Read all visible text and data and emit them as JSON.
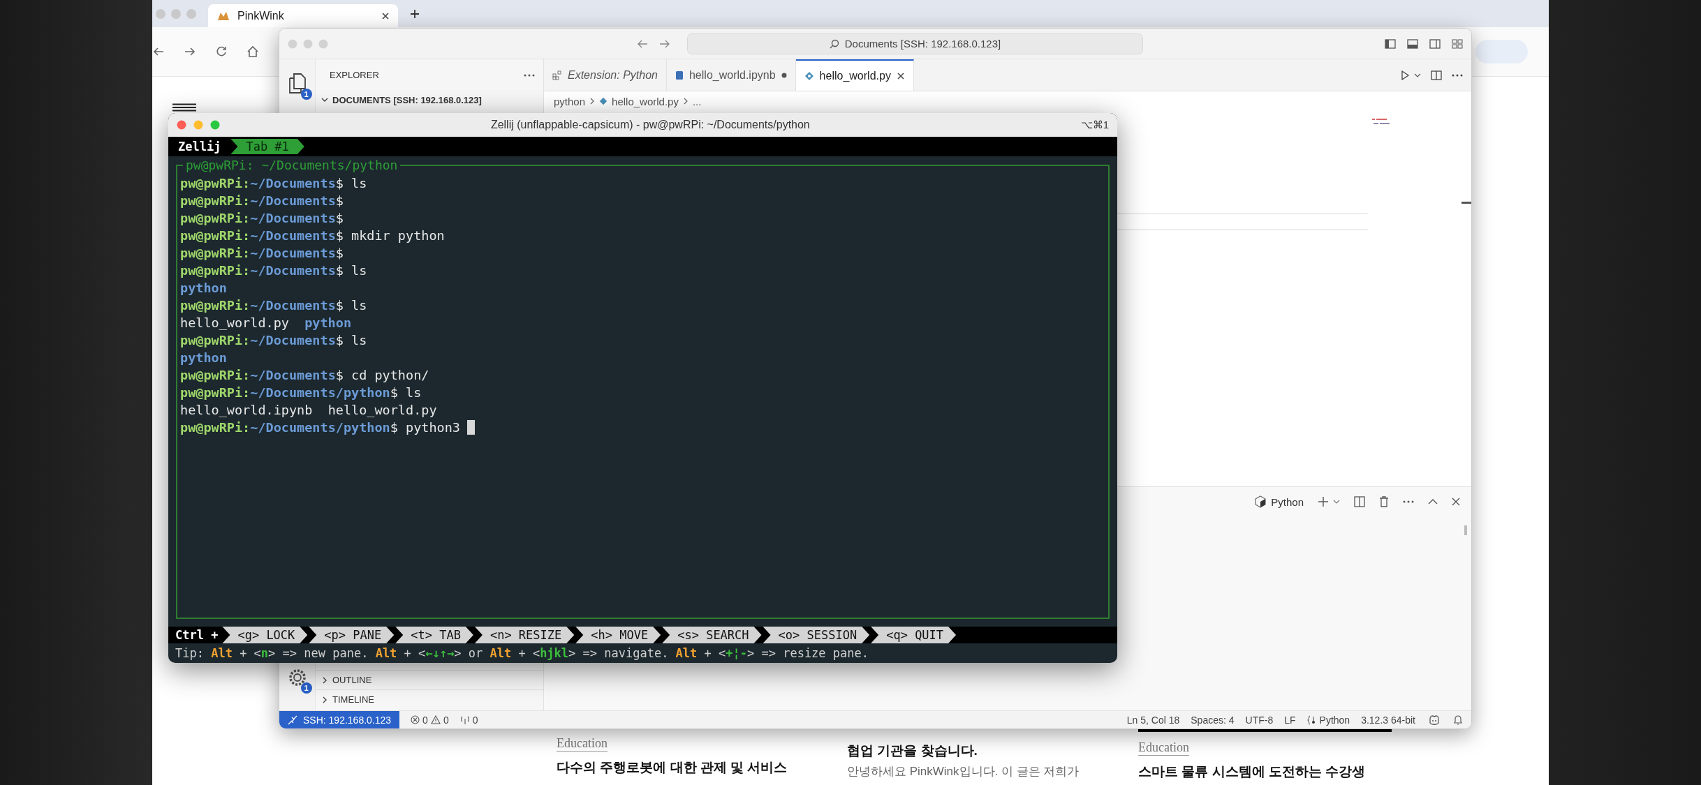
{
  "browser": {
    "tab_title": "PinkWink"
  },
  "page": {
    "columns": [
      {
        "category": "Education",
        "title": "다수의 주행로봇에 대한 관제 및 서비스"
      },
      {
        "title": "협업 기관을 찾습니다.",
        "excerpt": "안녕하세요 PinkWink입니다. 이 글은 저희가"
      },
      {
        "banner": true,
        "category": "Education",
        "title": "스마트 물류 시스템에 도전하는 수강생"
      }
    ]
  },
  "vscode": {
    "search": "Documents [SSH: 192.168.0.123]",
    "explorer_badge": "1",
    "settings_badge": "1",
    "explorer_title": "EXPLORER",
    "folder": {
      "label": "DOCUMENTS [SSH: 192.168.0.123]",
      "expanded": true
    },
    "sections": [
      {
        "label": "OUTLINE",
        "expanded": false
      },
      {
        "label": "TIMELINE",
        "expanded": false
      }
    ],
    "tabs": [
      {
        "label": "Extension: Python",
        "kind": "extension",
        "selected": false,
        "dirty": false
      },
      {
        "label": "hello_world.ipynb",
        "kind": "notebook",
        "selected": false,
        "dirty": true
      },
      {
        "label": "hello_world.py",
        "kind": "python",
        "selected": true,
        "dirty": false
      }
    ],
    "breadcrumb": [
      "python",
      "hello_world.py",
      "..."
    ],
    "panel": {
      "terminal_label": "Python"
    },
    "status_bar": {
      "remote": "SSH: 192.168.0.123",
      "errors": "0",
      "warnings": "0",
      "ports": "0",
      "position": "Ln 5, Col 18",
      "indent": "Spaces: 4",
      "encoding": "UTF-8",
      "eol": "LF",
      "language": "Python",
      "interpreter": "3.12.3 64-bit"
    }
  },
  "zellij": {
    "title": "Zellij (unflappable-capsicum) - pw@pwRPi: ~/Documents/python",
    "shortcut": "⌥⌘1",
    "session_label": "Zellij",
    "tabs": [
      {
        "label": "Tab #1",
        "selected": true
      }
    ],
    "pane_title": "pw@pwRPi: ~/Documents/python",
    "lines": [
      {
        "kind": "prompt",
        "user": "pw@pwRPi:",
        "path": "~/Documents",
        "sign": "$",
        "command": "ls"
      },
      {
        "kind": "prompt",
        "user": "pw@pwRPi:",
        "path": "~/Documents",
        "sign": "$"
      },
      {
        "kind": "prompt",
        "user": "pw@pwRPi:",
        "path": "~/Documents",
        "sign": "$"
      },
      {
        "kind": "prompt",
        "user": "pw@pwRPi:",
        "path": "~/Documents",
        "sign": "$",
        "command": "mkdir python"
      },
      {
        "kind": "prompt",
        "user": "pw@pwRPi:",
        "path": "~/Documents",
        "sign": "$"
      },
      {
        "kind": "prompt",
        "user": "pw@pwRPi:",
        "path": "~/Documents",
        "sign": "$",
        "command": "ls"
      },
      {
        "kind": "output",
        "items": [
          {
            "text": "python",
            "dir": true
          }
        ]
      },
      {
        "kind": "prompt",
        "user": "pw@pwRPi:",
        "path": "~/Documents",
        "sign": "$",
        "command": "ls"
      },
      {
        "kind": "output",
        "items": [
          {
            "text": "hello_world.py",
            "dir": false
          },
          {
            "text": "python",
            "dir": true
          }
        ]
      },
      {
        "kind": "prompt",
        "user": "pw@pwRPi:",
        "path": "~/Documents",
        "sign": "$",
        "command": "ls"
      },
      {
        "kind": "output",
        "items": [
          {
            "text": "python",
            "dir": true
          }
        ]
      },
      {
        "kind": "prompt",
        "user": "pw@pwRPi:",
        "path": "~/Documents",
        "sign": "$",
        "command": "cd python/"
      },
      {
        "kind": "prompt",
        "user": "pw@pwRPi:",
        "path": "~/Documents/python",
        "sign": "$",
        "command": "ls"
      },
      {
        "kind": "output",
        "items": [
          {
            "text": "hello_world.ipynb",
            "dir": false
          },
          {
            "text": "hello_world.py",
            "dir": false
          }
        ]
      },
      {
        "kind": "prompt",
        "user": "pw@pwRPi:",
        "path": "~/Documents/python",
        "sign": "$",
        "command": "python3",
        "cursor": true
      }
    ],
    "mode_label": "Ctrl +",
    "keys": [
      {
        "key": "<g>",
        "label": "LOCK"
      },
      {
        "key": "<p>",
        "label": "PANE"
      },
      {
        "key": "<t>",
        "label": "TAB"
      },
      {
        "key": "<n>",
        "label": "RESIZE"
      },
      {
        "key": "<h>",
        "label": "MOVE"
      },
      {
        "key": "<s>",
        "label": "SEARCH"
      },
      {
        "key": "<o>",
        "label": "SESSION"
      },
      {
        "key": "<q>",
        "label": "QUIT"
      }
    ],
    "tip": "Tip: **Alt** + <*n*> => new pane. **Alt** + <*←↓↑→*> or **Alt** + <*hjkl*> => navigate. **Alt** + <*+¦-*> => resize pane."
  }
}
